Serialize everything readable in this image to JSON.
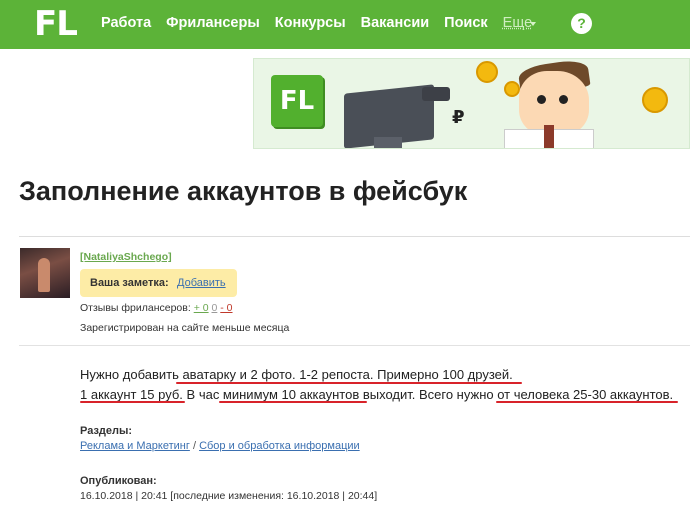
{
  "header": {
    "logo": "FL",
    "nav": [
      "Работа",
      "Фрилансеры",
      "Конкурсы",
      "Вакансии",
      "Поиск"
    ],
    "more_label": "Еще",
    "help_label": "?"
  },
  "banner": {
    "logo": "FL",
    "currency": "₽"
  },
  "project": {
    "title": "Заполнение аккаунтов в фейсбук",
    "description_line1": "Нужно добавить аватарку и 2 фото. 1-2 репоста. Примерно 100 друзей.",
    "description_line2": "1 аккаунт 15 руб. В час минимум 10 аккаунтов выходит. Всего нужно от человека 25-30 аккаунтов."
  },
  "author": {
    "username": "[NataliyaShchego]",
    "note_label": "Ваша заметка:",
    "note_add": "Добавить",
    "reviews_label": "Отзывы фрилансеров:",
    "reviews_pos": "+ 0",
    "reviews_neutral": "0",
    "reviews_neg": "- 0",
    "registered": "Зарегистрирован на сайте меньше месяца"
  },
  "sections": {
    "label": "Разделы:",
    "category": "Реклама и Маркетинг",
    "separator": "/",
    "subcategory": "Сбор и обработка информации"
  },
  "published": {
    "label": "Опубликован:",
    "value": "16.10.2018 | 20:41 [последние изменения: 16.10.2018 | 20:44]"
  },
  "colors": {
    "brand_green": "#5cb338",
    "annotation_red": "#d8232a",
    "note_yellow": "#fdeca6"
  }
}
